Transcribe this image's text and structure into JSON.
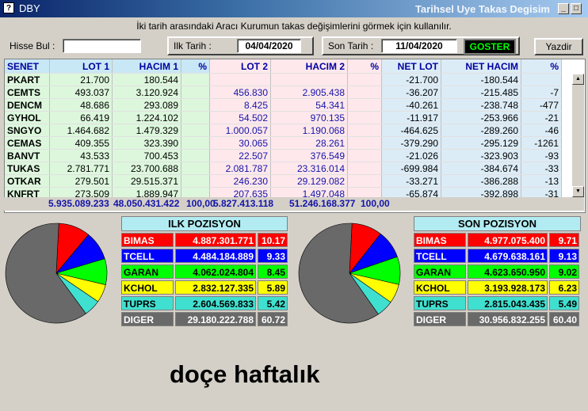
{
  "window": {
    "icon": "?",
    "title": "DBY",
    "subtitle": "Tarihsel Uye Takas Degisim",
    "min": "_",
    "max": "□",
    "close": "X"
  },
  "info_text": "İki tarih arasındaki  Aracı Kurumun takas değişimlerini görmek için kullanılır.",
  "toolbar": {
    "hisse_label": "Hisse Bul :",
    "hisse_value": "",
    "ilk_label": "Ilk Tarih :",
    "ilk_value": "04/04/2020",
    "son_label": "Son Tarih :",
    "son_value": "11/04/2020",
    "goster_label": "GOSTER",
    "yazdir_label": "Yazdir"
  },
  "table": {
    "headers": [
      "SENET",
      "LOT 1",
      "HACIM 1",
      "%",
      "LOT 2",
      "HACIM 2",
      "%",
      "NET LOT",
      "NET HACIM",
      "%"
    ],
    "rows": [
      [
        "PKART",
        "21.700",
        "180.544",
        "",
        "",
        "",
        "",
        "-21.700",
        "-180.544",
        ""
      ],
      [
        "CEMTS",
        "493.037",
        "3.120.924",
        "",
        "456.830",
        "2.905.438",
        "",
        "-36.207",
        "-215.485",
        "-7"
      ],
      [
        "DENCM",
        "48.686",
        "293.089",
        "",
        "8.425",
        "54.341",
        "",
        "-40.261",
        "-238.748",
        "-477"
      ],
      [
        "GYHOL",
        "66.419",
        "1.224.102",
        "",
        "54.502",
        "970.135",
        "",
        "-11.917",
        "-253.966",
        "-21"
      ],
      [
        "SNGYO",
        "1.464.682",
        "1.479.329",
        "",
        "1.000.057",
        "1.190.068",
        "",
        "-464.625",
        "-289.260",
        "-46"
      ],
      [
        "CEMAS",
        "409.355",
        "323.390",
        "",
        "30.065",
        "28.261",
        "",
        "-379.290",
        "-295.129",
        "-1261"
      ],
      [
        "BANVT",
        "43.533",
        "700.453",
        "",
        "22.507",
        "376.549",
        "",
        "-21.026",
        "-323.903",
        "-93"
      ],
      [
        "TUKAS",
        "2.781.771",
        "23.700.688",
        "",
        "2.081.787",
        "23.316.014",
        "",
        "-699.984",
        "-384.674",
        "-33"
      ],
      [
        "OTKAR",
        "279.501",
        "29.515.371",
        "",
        "246.230",
        "29.129.082",
        "",
        "-33.271",
        "-386.288",
        "-13"
      ],
      [
        "KNFRT",
        "273.509",
        "1.889.947",
        "",
        "207.635",
        "1.497.048",
        "",
        "-65.874",
        "-392.898",
        "-31"
      ]
    ],
    "totals": {
      "lot1": "5.935.089.233",
      "hacim1": "48.050.431.422",
      "pct1": "100,00",
      "lot2": "5.827.413.118",
      "hacim2": "51.246.168.377",
      "pct2": "100,00"
    }
  },
  "ilk_pozisyon": {
    "title": "ILK POZISYON",
    "rows": [
      {
        "name": "BIMAS",
        "value": "4.887.301.771",
        "pct": "10.17",
        "color": "#ff0000",
        "text": "#ffffff"
      },
      {
        "name": "TCELL",
        "value": "4.484.184.889",
        "pct": "9.33",
        "color": "#0000ff",
        "text": "#ffffff"
      },
      {
        "name": "GARAN",
        "value": "4.062.024.804",
        "pct": "8.45",
        "color": "#00ff00",
        "text": "#000000"
      },
      {
        "name": "KCHOL",
        "value": "2.832.127.335",
        "pct": "5.89",
        "color": "#ffff00",
        "text": "#000000"
      },
      {
        "name": "TUPRS",
        "value": "2.604.569.833",
        "pct": "5.42",
        "color": "#40e0d0",
        "text": "#000000"
      },
      {
        "name": "DIGER",
        "value": "29.180.222.788",
        "pct": "60.72",
        "color": "#696969",
        "text": "#ffffff"
      }
    ]
  },
  "son_pozisyon": {
    "title": "SON POZISYON",
    "rows": [
      {
        "name": "BIMAS",
        "value": "4.977.075.400",
        "pct": "9.71",
        "color": "#ff0000",
        "text": "#ffffff"
      },
      {
        "name": "TCELL",
        "value": "4.679.638.161",
        "pct": "9.13",
        "color": "#0000ff",
        "text": "#ffffff"
      },
      {
        "name": "GARAN",
        "value": "4.623.650.950",
        "pct": "9.02",
        "color": "#00ff00",
        "text": "#000000"
      },
      {
        "name": "KCHOL",
        "value": "3.193.928.173",
        "pct": "6.23",
        "color": "#ffff00",
        "text": "#000000"
      },
      {
        "name": "TUPRS",
        "value": "2.815.043.435",
        "pct": "5.49",
        "color": "#40e0d0",
        "text": "#000000"
      },
      {
        "name": "DIGER",
        "value": "30.956.832.255",
        "pct": "60.40",
        "color": "#696969",
        "text": "#ffffff"
      }
    ]
  },
  "caption": "doçe haftalık"
}
